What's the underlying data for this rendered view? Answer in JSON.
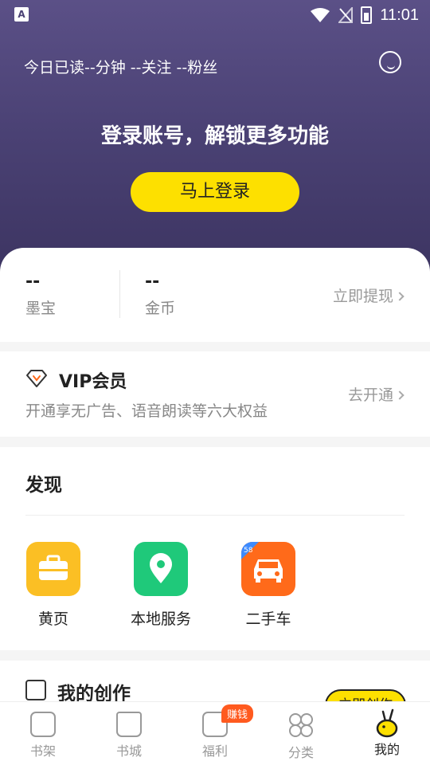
{
  "status_bar": {
    "time": "11:01",
    "left_icon": "A"
  },
  "hero": {
    "stats": "今日已读--分钟 --关注 --粉丝",
    "prompt": "登录账号，解锁更多功能",
    "login_button": "马上登录"
  },
  "wallet": {
    "ink_value": "--",
    "ink_label": "墨宝",
    "coin_value": "--",
    "coin_label": "金币",
    "withdraw": "立即提现"
  },
  "vip": {
    "title": "VIP会员",
    "desc": "开通享无广告、语音朗读等六大权益",
    "action": "去开通"
  },
  "discover": {
    "title": "发现",
    "items": [
      {
        "label": "黄页",
        "icon": "briefcase-icon",
        "color": "#fbbf24"
      },
      {
        "label": "本地服务",
        "icon": "location-pin-icon",
        "color": "#1fc97a"
      },
      {
        "label": "二手车",
        "icon": "car-icon",
        "color": "#ff6a1a",
        "tag": "58"
      }
    ]
  },
  "creation": {
    "title": "我的创作",
    "button": "立即创作"
  },
  "tabs": [
    {
      "label": "书架",
      "icon": "bookshelf-icon"
    },
    {
      "label": "书城",
      "icon": "bookstore-icon"
    },
    {
      "label": "福利",
      "icon": "welfare-icon",
      "badge": "赚钱"
    },
    {
      "label": "分类",
      "icon": "category-icon"
    },
    {
      "label": "我的",
      "icon": "profile-icon",
      "active": true
    }
  ],
  "colors": {
    "hero": "#4b4275",
    "accent": "#fde000",
    "badge": "#ff5a1f"
  }
}
